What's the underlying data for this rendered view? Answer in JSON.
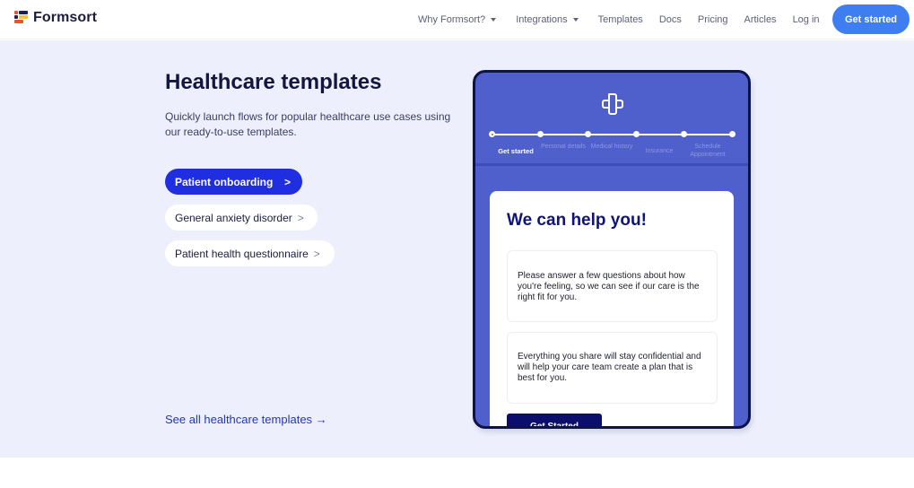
{
  "header": {
    "logo_text": "Formsort",
    "nav": [
      {
        "label": "Why Formsort?",
        "has_dropdown": true
      },
      {
        "label": "Integrations",
        "has_dropdown": true
      },
      {
        "label": "Templates",
        "has_dropdown": false
      },
      {
        "label": "Docs",
        "has_dropdown": false
      },
      {
        "label": "Pricing",
        "has_dropdown": false
      },
      {
        "label": "Articles",
        "has_dropdown": false
      },
      {
        "label": "Log in",
        "has_dropdown": false
      }
    ],
    "cta_label": "Get started",
    "colors": {
      "cta": "#3e7ef0",
      "logo_red": "#e4572e",
      "logo_yellow": "#f6c244",
      "logo_navy": "#1c1f5a"
    }
  },
  "hero": {
    "title": "Healthcare templates",
    "subtitle": "Quickly launch flows for popular healthcare use cases using our ready-to-use templates.",
    "templates": [
      {
        "label": "Patient onboarding",
        "active": true
      },
      {
        "label": "General anxiety disorder",
        "active": false
      },
      {
        "label": "Patient health questionnaire",
        "active": false
      }
    ],
    "chevron": ">",
    "see_all_label": "See all healthcare templates →",
    "colors": {
      "background": "#edf0fc",
      "active_pill": "#1f2ee0",
      "link": "#2435b8"
    }
  },
  "preview": {
    "icon": "medical-cross-icon",
    "steps": [
      {
        "label": "Get started",
        "active": true
      },
      {
        "label": "Personal details",
        "active": false
      },
      {
        "label": "Medical history",
        "active": false
      },
      {
        "label": "Insurance",
        "active": false
      },
      {
        "label": "Schedule Appointment",
        "active": false
      }
    ],
    "card_title": "We can help you!",
    "paragraphs": [
      "Please answer a few questions about how you're feeling, so we can see if our care is the right fit for you.",
      "Everything you share will stay confidential and will help your care team create a plan that is best for you."
    ],
    "button_label": "Get Started",
    "colors": {
      "frame": "#4f5fcb",
      "border": "#0d1345",
      "title": "#0f137a",
      "button": "#0b0e6b"
    }
  }
}
